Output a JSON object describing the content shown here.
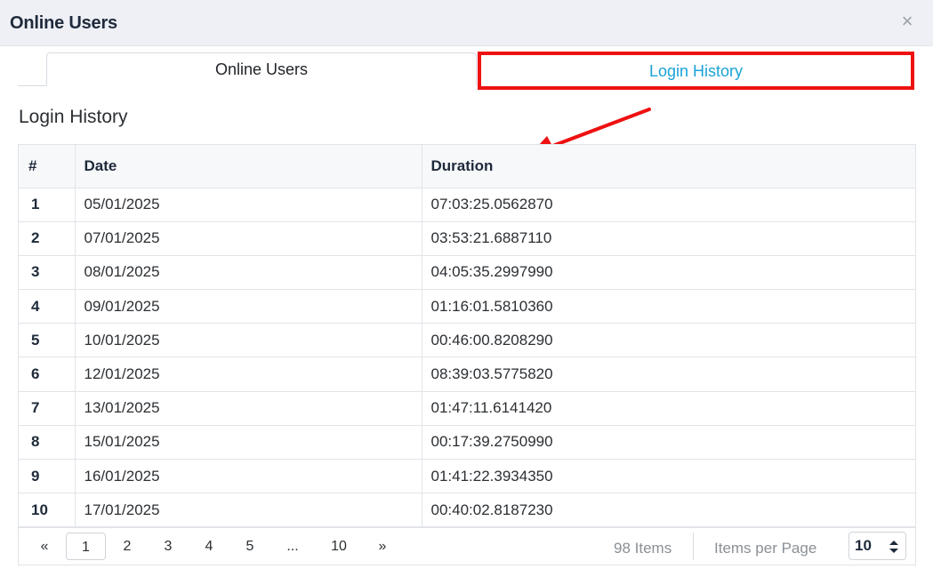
{
  "modal": {
    "title": "Online Users",
    "close_label": "×"
  },
  "tabs": [
    {
      "label": "Online Users",
      "active": false
    },
    {
      "label": "Login History",
      "active": true
    }
  ],
  "section_title": "Login History",
  "table": {
    "headers": [
      "#",
      "Date",
      "Duration"
    ],
    "rows": [
      {
        "num": "1",
        "date": "05/01/2025",
        "duration": "07:03:25.0562870"
      },
      {
        "num": "2",
        "date": "07/01/2025",
        "duration": "03:53:21.6887110"
      },
      {
        "num": "3",
        "date": "08/01/2025",
        "duration": "04:05:35.2997990"
      },
      {
        "num": "4",
        "date": "09/01/2025",
        "duration": "01:16:01.5810360"
      },
      {
        "num": "5",
        "date": "10/01/2025",
        "duration": "00:46:00.8208290"
      },
      {
        "num": "6",
        "date": "12/01/2025",
        "duration": "08:39:03.5775820"
      },
      {
        "num": "7",
        "date": "13/01/2025",
        "duration": "01:47:11.6141420"
      },
      {
        "num": "8",
        "date": "15/01/2025",
        "duration": "00:17:39.2750990"
      },
      {
        "num": "9",
        "date": "16/01/2025",
        "duration": "01:41:22.3934350"
      },
      {
        "num": "10",
        "date": "17/01/2025",
        "duration": "00:40:02.8187230"
      }
    ]
  },
  "pagination": {
    "first_label": "«",
    "pages": [
      "1",
      "2",
      "3",
      "4",
      "5",
      "...",
      "10"
    ],
    "current_page": "1",
    "last_label": "»",
    "items_count": "98 Items",
    "items_per_page_label": "Items per Page",
    "items_per_page_value": "10"
  },
  "colors": {
    "active_tab_text": "#1aa3d6",
    "highlight_box": "#ee1111",
    "annotation_arrow": "#ee1111"
  },
  "icons": {
    "close": "close-icon",
    "select_arrows": "sort-updown-icon",
    "annotation": "arrow-icon"
  }
}
